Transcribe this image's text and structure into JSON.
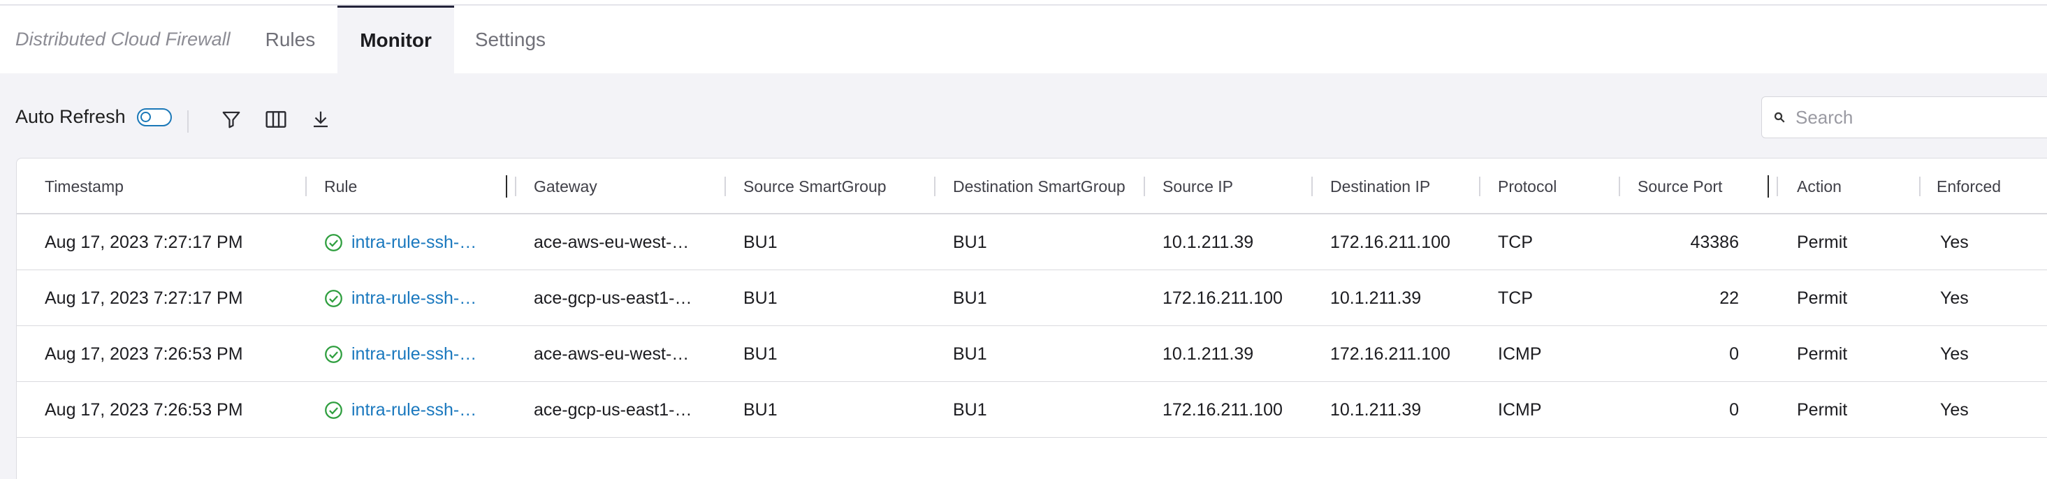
{
  "nav": {
    "brand": "Distributed Cloud Firewall",
    "tabs": [
      {
        "label": "Rules",
        "active": false
      },
      {
        "label": "Monitor",
        "active": true
      },
      {
        "label": "Settings",
        "active": false
      }
    ]
  },
  "toolbar": {
    "auto_refresh_label": "Auto Refresh",
    "auto_refresh_on": false,
    "icons": [
      "filter-icon",
      "columns-icon",
      "download-icon"
    ]
  },
  "search": {
    "placeholder": "Search",
    "value": ""
  },
  "table": {
    "columns": [
      "Timestamp",
      "Rule",
      "Gateway",
      "Source SmartGroup",
      "Destination SmartGroup",
      "Source IP",
      "Destination IP",
      "Protocol",
      "Source Port",
      "Action",
      "Enforced"
    ],
    "rows": [
      {
        "timestamp": "Aug 17, 2023 7:27:17 PM",
        "rule": "intra-rule-ssh-…",
        "gateway": "ace-aws-eu-west-…",
        "src_group": "BU1",
        "dst_group": "BU1",
        "src_ip": "10.1.211.39",
        "dst_ip": "172.16.211.100",
        "protocol": "TCP",
        "src_port": "43386",
        "action": "Permit",
        "enforced": "Yes"
      },
      {
        "timestamp": "Aug 17, 2023 7:27:17 PM",
        "rule": "intra-rule-ssh-…",
        "gateway": "ace-gcp-us-east1-…",
        "src_group": "BU1",
        "dst_group": "BU1",
        "src_ip": "172.16.211.100",
        "dst_ip": "10.1.211.39",
        "protocol": "TCP",
        "src_port": "22",
        "action": "Permit",
        "enforced": "Yes"
      },
      {
        "timestamp": "Aug 17, 2023 7:26:53 PM",
        "rule": "intra-rule-ssh-…",
        "gateway": "ace-aws-eu-west-…",
        "src_group": "BU1",
        "dst_group": "BU1",
        "src_ip": "10.1.211.39",
        "dst_ip": "172.16.211.100",
        "protocol": "ICMP",
        "src_port": "0",
        "action": "Permit",
        "enforced": "Yes"
      },
      {
        "timestamp": "Aug 17, 2023 7:26:53 PM",
        "rule": "intra-rule-ssh-…",
        "gateway": "ace-gcp-us-east1-…",
        "src_group": "BU1",
        "dst_group": "BU1",
        "src_ip": "172.16.211.100",
        "dst_ip": "10.1.211.39",
        "protocol": "ICMP",
        "src_port": "0",
        "action": "Permit",
        "enforced": "Yes"
      }
    ]
  },
  "colors": {
    "link": "#1a78be",
    "success": "#2e9e3e",
    "toggle": "#1b78b8"
  }
}
